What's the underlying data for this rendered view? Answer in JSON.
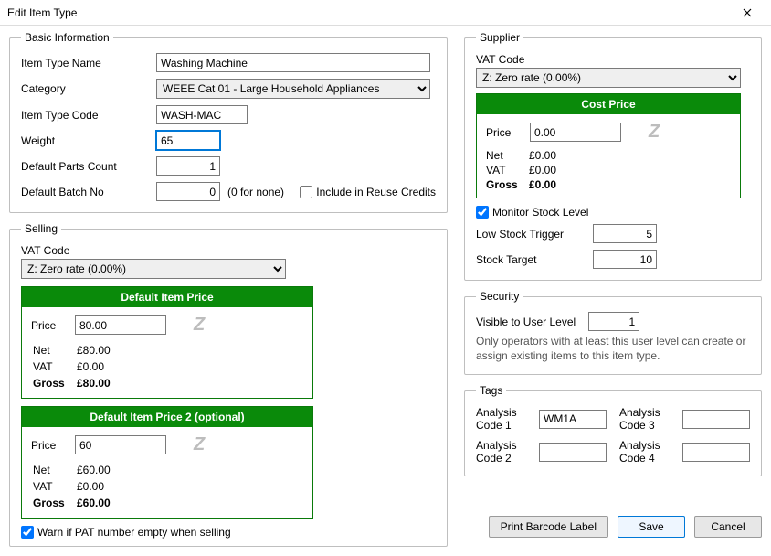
{
  "window": {
    "title": "Edit Item Type"
  },
  "basic": {
    "legend": "Basic Information",
    "name_label": "Item Type Name",
    "name_value": "Washing Machine",
    "category_label": "Category",
    "category_value": "WEEE Cat 01 - Large Household Appliances",
    "code_label": "Item Type Code",
    "code_value": "WASH-MAC",
    "weight_label": "Weight",
    "weight_value": "65",
    "parts_label": "Default Parts Count",
    "parts_value": "1",
    "batch_label": "Default Batch No",
    "batch_value": "0",
    "batch_hint": "(0 for none)",
    "include_reuse_label": "Include in Reuse Credits",
    "include_reuse_checked": false
  },
  "selling": {
    "legend": "Selling",
    "vatcode_label": "VAT Code",
    "vatcode_value": "Z: Zero rate (0.00%)",
    "price1": {
      "header": "Default Item Price",
      "price_label": "Price",
      "price_value": "80.00",
      "z": "Z",
      "net_label": "Net",
      "net_value": "£80.00",
      "vat_label": "VAT",
      "vat_value": "£0.00",
      "gross_label": "Gross",
      "gross_value": "£80.00"
    },
    "price2": {
      "header": "Default Item Price 2 (optional)",
      "price_label": "Price",
      "price_value": "60",
      "z": "Z",
      "net_label": "Net",
      "net_value": "£60.00",
      "vat_label": "VAT",
      "vat_value": "£0.00",
      "gross_label": "Gross",
      "gross_value": "£60.00"
    },
    "warn_pat_label": "Warn if PAT number empty when selling",
    "warn_pat_checked": true
  },
  "supplier": {
    "legend": "Supplier",
    "vatcode_label": "VAT Code",
    "vatcode_value": "Z: Zero rate (0.00%)",
    "cost": {
      "header": "Cost Price",
      "price_label": "Price",
      "price_value": "0.00",
      "z": "Z",
      "net_label": "Net",
      "net_value": "£0.00",
      "vat_label": "VAT",
      "vat_value": "£0.00",
      "gross_label": "Gross",
      "gross_value": "£0.00"
    },
    "monitor_label": "Monitor Stock Level",
    "monitor_checked": true,
    "low_trigger_label": "Low Stock Trigger",
    "low_trigger_value": "5",
    "stock_target_label": "Stock Target",
    "stock_target_value": "10"
  },
  "security": {
    "legend": "Security",
    "visible_label": "Visible to User Level",
    "visible_value": "1",
    "help_text": "Only operators with at least this user level can create or assign existing items to this item type."
  },
  "tags": {
    "legend": "Tags",
    "code1_label": "Analysis Code 1",
    "code1_value": "WM1A",
    "code2_label": "Analysis Code 2",
    "code2_value": "",
    "code3_label": "Analysis Code 3",
    "code3_value": "",
    "code4_label": "Analysis Code 4",
    "code4_value": ""
  },
  "footer": {
    "print_label": "Print Barcode Label",
    "save_label": "Save",
    "cancel_label": "Cancel"
  }
}
